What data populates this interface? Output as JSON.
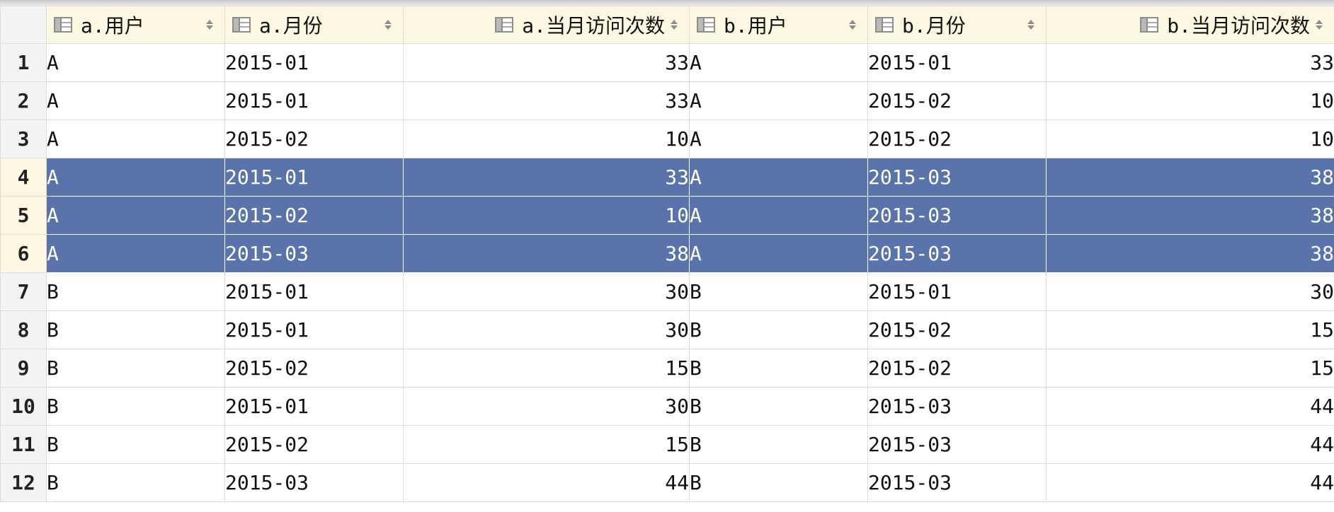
{
  "columns": [
    {
      "label": "a.用户",
      "align": "left"
    },
    {
      "label": "a.月份",
      "align": "left"
    },
    {
      "label": "a.当月访问次数",
      "align": "right"
    },
    {
      "label": "b.用户",
      "align": "left"
    },
    {
      "label": "b.月份",
      "align": "left"
    },
    {
      "label": "b.当月访问次数",
      "align": "right"
    }
  ],
  "rows": [
    {
      "n": "1",
      "cells": [
        "A",
        "2015-01",
        "33",
        "A",
        "2015-01",
        "33"
      ],
      "selected": false
    },
    {
      "n": "2",
      "cells": [
        "A",
        "2015-01",
        "33",
        "A",
        "2015-02",
        "10"
      ],
      "selected": false
    },
    {
      "n": "3",
      "cells": [
        "A",
        "2015-02",
        "10",
        "A",
        "2015-02",
        "10"
      ],
      "selected": false
    },
    {
      "n": "4",
      "cells": [
        "A",
        "2015-01",
        "33",
        "A",
        "2015-03",
        "38"
      ],
      "selected": true
    },
    {
      "n": "5",
      "cells": [
        "A",
        "2015-02",
        "10",
        "A",
        "2015-03",
        "38"
      ],
      "selected": true
    },
    {
      "n": "6",
      "cells": [
        "A",
        "2015-03",
        "38",
        "A",
        "2015-03",
        "38"
      ],
      "selected": true
    },
    {
      "n": "7",
      "cells": [
        "B",
        "2015-01",
        "30",
        "B",
        "2015-01",
        "30"
      ],
      "selected": false
    },
    {
      "n": "8",
      "cells": [
        "B",
        "2015-01",
        "30",
        "B",
        "2015-02",
        "15"
      ],
      "selected": false
    },
    {
      "n": "9",
      "cells": [
        "B",
        "2015-02",
        "15",
        "B",
        "2015-02",
        "15"
      ],
      "selected": false
    },
    {
      "n": "10",
      "cells": [
        "B",
        "2015-01",
        "30",
        "B",
        "2015-03",
        "44"
      ],
      "selected": false
    },
    {
      "n": "11",
      "cells": [
        "B",
        "2015-02",
        "15",
        "B",
        "2015-03",
        "44"
      ],
      "selected": false
    },
    {
      "n": "12",
      "cells": [
        "B",
        "2015-03",
        "44",
        "B",
        "2015-03",
        "44"
      ],
      "selected": false
    }
  ],
  "colors": {
    "selection": "#5a73aa",
    "header": "#fdf8e1",
    "rownum": "#f3f3f3"
  },
  "icons": {
    "column": "table-column-icon",
    "sort": "sort-arrows-icon"
  }
}
